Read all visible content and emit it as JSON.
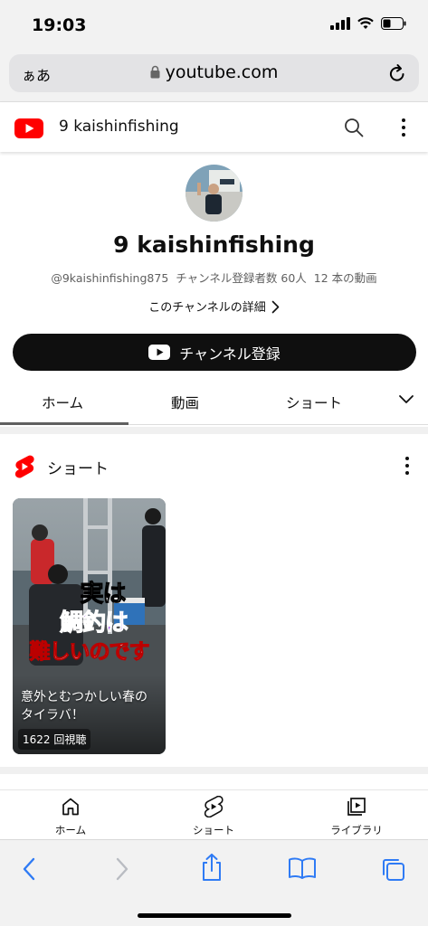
{
  "status_bar": {
    "time": "19:03"
  },
  "browser": {
    "aa_label": "ぁあ",
    "url": "youtube.com"
  },
  "header": {
    "channel_title": "9 kaishinfishing"
  },
  "channel": {
    "name": "9 kaishinfishing",
    "handle": "@9kaishinfishing875",
    "subscribers": "チャンネル登録者数 60人",
    "video_count": "12 本の動画",
    "details_link": "このチャンネルの詳細",
    "subscribe_label": "チャンネル登録"
  },
  "tabs": [
    {
      "label": "ホーム",
      "active": true
    },
    {
      "label": "動画"
    },
    {
      "label": "ショート"
    }
  ],
  "shorts_section": {
    "title": "ショート",
    "items": [
      {
        "overlay_lines": [
          "実は",
          "鯛釣は",
          "難しいのです"
        ],
        "caption": "意外とむつかしい春のタイラバ！",
        "views": "1622 回視聴"
      }
    ]
  },
  "bottom_nav": [
    {
      "label": "ホーム",
      "icon": "home-icon"
    },
    {
      "label": "ショート",
      "icon": "shorts-icon"
    },
    {
      "label": "ライブラリ",
      "icon": "library-icon"
    }
  ],
  "colors": {
    "brand_red": "#ff0000",
    "safari_blue": "#2f7bf5",
    "overlay_purple": "#8a2be2"
  }
}
